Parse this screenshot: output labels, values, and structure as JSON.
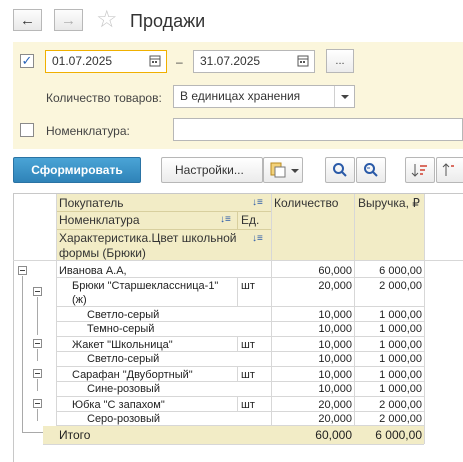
{
  "header": {
    "title": "Продажи",
    "back_label": "←",
    "forward_label": "→",
    "star_label": "☆"
  },
  "filters": {
    "period_enabled": "✓",
    "date_from": "01.07.2025",
    "date_to": "31.07.2025",
    "dash": "–",
    "period_button": "...",
    "quantity_label": "Количество товаров:",
    "quantity_value": "В единицах хранения",
    "nomenclature_label": "Номенклатура:",
    "nomenclature_value": ""
  },
  "toolbar": {
    "generate_label": "Сформировать",
    "settings_label": "Настройки...",
    "calendar_icon": "calendar-icon",
    "dropdown_icon": "chevron-down-icon"
  },
  "report": {
    "headers": {
      "buyer": "Покупатель",
      "nomenclature": "Номенклатура",
      "unit": "Ед.",
      "characteristic": "Характеристика.Цвет школьной формы (Брюки)",
      "quantity": "Количество",
      "revenue": "Выручка, ₽"
    },
    "rows": [
      {
        "name": "Иванова А.А,",
        "unit": "",
        "qty": "60,000",
        "rev": "6 000,00"
      },
      {
        "name": "Брюки \"Старшеклассница-1\" (ж)",
        "unit": "шт",
        "qty": "20,000",
        "rev": "2 000,00"
      },
      {
        "name": "Светло-серый",
        "unit": "",
        "qty": "10,000",
        "rev": "1 000,00"
      },
      {
        "name": "Темно-серый",
        "unit": "",
        "qty": "10,000",
        "rev": "1 000,00"
      },
      {
        "name": "Жакет \"Школьница\"",
        "unit": "шт",
        "qty": "10,000",
        "rev": "1 000,00"
      },
      {
        "name": "Светло-серый",
        "unit": "",
        "qty": "10,000",
        "rev": "1 000,00"
      },
      {
        "name": "Сарафан \"Двубортный\"",
        "unit": "шт",
        "qty": "10,000",
        "rev": "1 000,00"
      },
      {
        "name": "Сине-розовый",
        "unit": "",
        "qty": "10,000",
        "rev": "1 000,00"
      },
      {
        "name": "Юбка \"С запахом\"",
        "unit": "шт",
        "qty": "20,000",
        "rev": "2 000,00"
      },
      {
        "name": "Серо-розовый",
        "unit": "",
        "qty": "20,000",
        "rev": "2 000,00"
      }
    ],
    "total": {
      "label": "Итого",
      "qty": "60,000",
      "rev": "6 000,00"
    }
  }
}
